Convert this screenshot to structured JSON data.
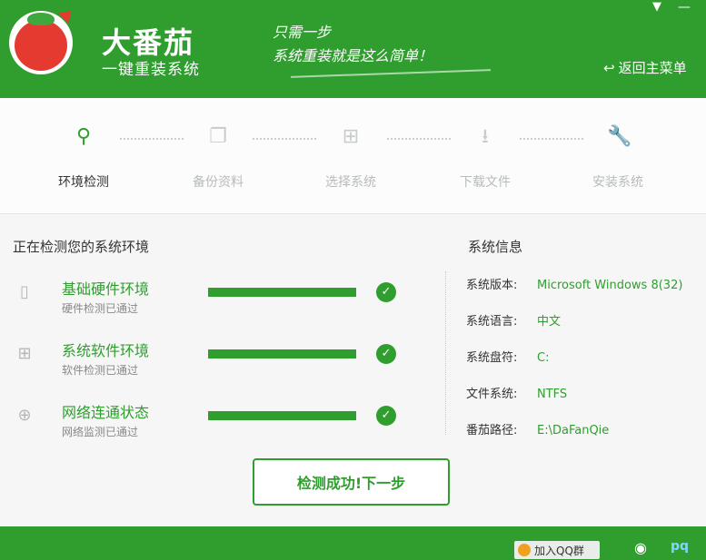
{
  "header": {
    "brand_title": "大番茄",
    "brand_sub": "一键重装系统",
    "slogan_1": "只需一步",
    "slogan_2": "系统重装就是这么简单！",
    "back_label": "返回主菜单",
    "menu_glyph": "▼",
    "minimize_glyph": "—",
    "back_glyph": "↩"
  },
  "steps": [
    {
      "label": "环境检测",
      "icon": "search-icon",
      "glyph": "⚲",
      "active": true
    },
    {
      "label": "备份资料",
      "icon": "copy-icon",
      "glyph": "❐",
      "active": false
    },
    {
      "label": "选择系统",
      "icon": "windows-icon",
      "glyph": "⊞",
      "active": false
    },
    {
      "label": "下载文件",
      "icon": "download-icon",
      "glyph": "⭳",
      "active": false
    },
    {
      "label": "安装系统",
      "icon": "wrench-icon",
      "glyph": "🔧",
      "active": false
    }
  ],
  "main": {
    "section_title": "正在检测您的系统环境",
    "checks": [
      {
        "title": "基础硬件环境",
        "sub": "硬件检测已通过",
        "icon": "hardware-icon",
        "glyph": "▯",
        "progress": 1.0
      },
      {
        "title": "系统软件环境",
        "sub": "软件检测已通过",
        "icon": "windows-icon",
        "glyph": "⊞",
        "progress": 1.0
      },
      {
        "title": "网络连通状态",
        "sub": "网络监测已通过",
        "icon": "globe-icon",
        "glyph": "⊕",
        "progress": 1.0
      }
    ],
    "check_glyph": "✓",
    "next_button": "检测成功!下一步"
  },
  "info": {
    "title": "系统信息",
    "rows": [
      {
        "key": "系统版本:",
        "value": "Microsoft Windows 8(32)"
      },
      {
        "key": "系统语言:",
        "value": "中文"
      },
      {
        "key": "系统盘符:",
        "value": "C:"
      },
      {
        "key": "文件系统:",
        "value": "NTFS"
      },
      {
        "key": "番茄路径:",
        "value": "E:\\DaFanQie"
      }
    ]
  },
  "footer": {
    "qq_label": "加入QQ群",
    "weibo_glyph": "◉",
    "pq_glyph": "pq"
  },
  "colors": {
    "accent": "#2f9e2f",
    "tomato": "#e53a2f"
  }
}
